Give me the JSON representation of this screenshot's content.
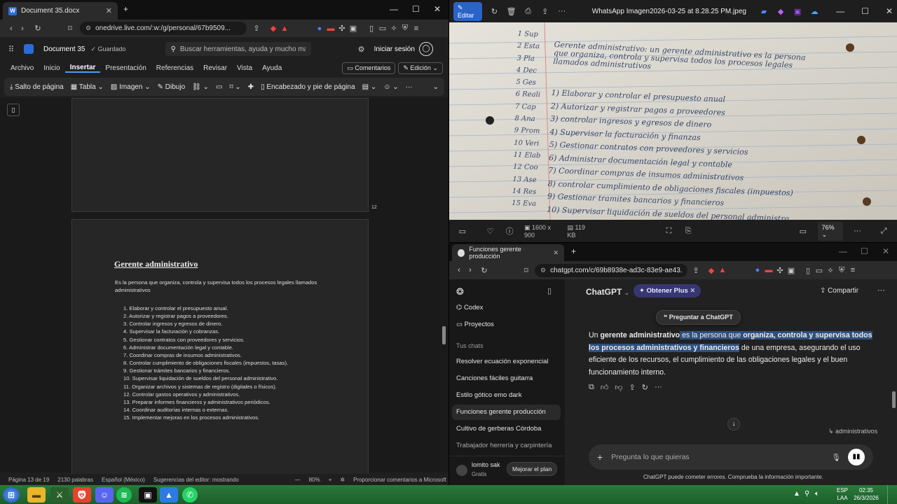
{
  "word": {
    "tab_title": "Document 35.docx",
    "url": "onedrive.live.com/:w:/g/personal/67b9509...",
    "doc_name": "Document 35",
    "saved": "Guardado",
    "search_placeholder": "Buscar herramientas, ayuda y mucho más (",
    "signin": "Iniciar sesión",
    "menu": [
      "Archivo",
      "Inicio",
      "Insertar",
      "Presentación",
      "Referencias",
      "Revisar",
      "Vista",
      "Ayuda"
    ],
    "comments_btn": "Comentarios",
    "edit_btn": "Edición",
    "ribbon": {
      "page_break": "Salto de página",
      "table": "Tabla",
      "image": "Imagen",
      "drawing": "Dibujo",
      "header_footer": "Encabezado y pie de página"
    },
    "page_number": "12",
    "doc": {
      "heading": "Gerente administrativo",
      "intro": "Es la persona que organiza, controla y supervisa todos los procesos legales llamados administrativos",
      "items": [
        "1.   Elaborar y controlar el presupuesto anual.",
        "2.   Autorizar y registrar pagos a proveedores.",
        "3.   Controlar ingresos y egresos de dinero.",
        "4.   Supervisar la facturación y cobranzas.",
        "5.   Gestionar contratos con proveedores y servicios.",
        "6.   Administrar documentación legal y contable.",
        "7.   Coordinar compras de insumos administrativos.",
        "8.   Controlar cumplimiento de obligaciones fiscales (impuestos, tasas).",
        "9.   Gestionar trámites bancarios y financieros.",
        "10. Supervisar liquidación de sueldos del personal administrativo.",
        "11. Organizar archivos y sistemas de registro (digitales o físicos).",
        "12. Controlar gastos operativos y administrativos.",
        "13. Preparar informes financieros y administrativos periódicos.",
        "14. Coordinar auditorías internas o externas.",
        "15. Implementar mejoras en los procesos administrativos."
      ]
    },
    "status": {
      "page": "Página 13 de 19",
      "words": "2130 palabras",
      "language": "Español (México)",
      "editor": "Sugerencias del editor: mostrando",
      "zoom": "80%",
      "feedback": "Proporcionar comentarios a Microsoft"
    }
  },
  "viewer": {
    "edit": "Editar",
    "filename": "WhatsApp Imagen2026-03-25 at 8.28.25 PM.jpeg",
    "dims": "1600 x 900",
    "size": "119 KB",
    "zoom": "76%",
    "notes": {
      "header1": "Gerente administrativo: un gerente administrativo es la persona",
      "header2": "que organiza, controla y supervisa todos los procesos legales",
      "header3": "llamados administrativos",
      "margin": [
        "1 Sup",
        "2 Esta",
        "3 Pla",
        "4 Dec",
        "5 Ges",
        "6 Reali",
        "7 Cap",
        "8 Ana",
        "9 Prom",
        "10 Veri",
        "11 Elab",
        "12 Coo",
        "13 Ase",
        "14 Res",
        "15 Eva"
      ],
      "lines": [
        "1) Elaborar y controlar el presupuesto anual",
        "2) Autorizar y registrar pagos a proveedores",
        "3) controlar ingresos y egresos de dinero",
        "4) Supervisar la facturación y finanzas",
        "5) Gestionar contratos con proveedores y servicios",
        "6) Administrar documentación legal y contable",
        "7) Coordinar compras de insumos administrativos",
        "8) controlar cumplimiento de obligaciones fiscales (impuestos)",
        "9) Gestionar tramites bancarios y financieros",
        "10) Supervisar liquidación de sueldos del personal administra."
      ]
    }
  },
  "chat": {
    "tab_title": "Funciones gerente producción",
    "url": "chatgpt.com/c/69b8938e-ad3c-83e9-ae43...",
    "sidebar": {
      "codex": "Codex",
      "projects": "Proyectos",
      "section": "Tus chats",
      "chats": [
        "Resolver ecuación exponencial",
        "Canciones fáciles guitarra",
        "Estilo gótico emo dark",
        "Funciones gerente producción",
        "Cultivo de gerberas Córdoba",
        "Trabajador herrería y carpintería"
      ],
      "user": "lomito sak",
      "plan": "Gratis",
      "upgrade": "Mejorar el plan"
    },
    "header": {
      "model": "ChatGPT",
      "plus": "Obtener Plus",
      "share": "Compartir"
    },
    "ask": "Preguntar a ChatGPT",
    "message": {
      "p1": "Un ",
      "b1": "gerente administrativo",
      "p2": " es la persona que ",
      "b2": "organiza, controla y supervisa todos los procesos administrativos y financieros",
      "p3": " de una empresa, asegurando el uso eficiente de los recursos, el cumplimiento de las obligaciones legales y el buen funcionamiento interno."
    },
    "reply_chip": "administrativos",
    "input_placeholder": "Pregunta lo que quieras",
    "disclaimer": "ChatGPT puede cometer errores. Comprueba la información importante."
  },
  "taskbar": {
    "lang1": "ESP",
    "lang2": "LAA",
    "time": "02:35",
    "date": "26/3/2026"
  }
}
